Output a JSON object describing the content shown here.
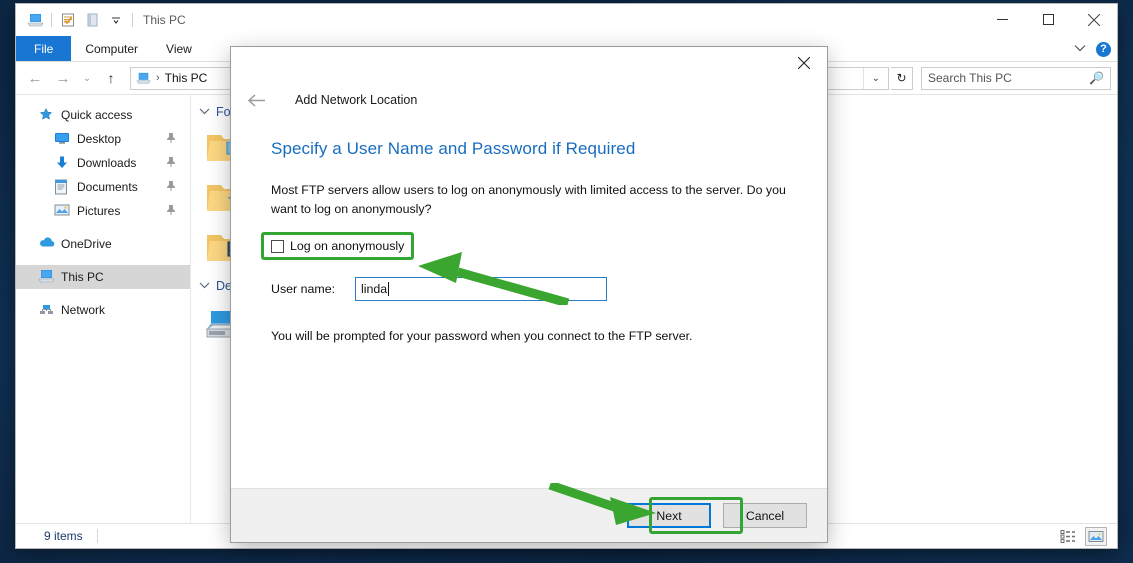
{
  "window": {
    "title": "This PC",
    "quick_access_icons": [
      "this-pc-icon",
      "properties-icon",
      "new-folder-icon",
      "customize-chevron-icon"
    ],
    "controls": {
      "minimize": "—",
      "maximize": "☐",
      "close": "✕"
    }
  },
  "ribbon": {
    "tabs": [
      {
        "label": "File",
        "active": true
      },
      {
        "label": "Computer",
        "active": false
      },
      {
        "label": "View",
        "active": false
      }
    ],
    "collapse_icon": "chevron-down-icon",
    "help_label": "?"
  },
  "addressbar": {
    "back_icon": "←",
    "forward_icon": "→",
    "recent_icon": "⌄",
    "up_icon": "↑",
    "crumb_icon": "this-pc-icon",
    "crumb": "This PC",
    "separator": "›",
    "dropdown_icon": "⌄",
    "refresh_icon": "↻",
    "search_placeholder": "Search This PC",
    "search_icon": "search-icon"
  },
  "navpane": {
    "items": [
      {
        "label": "Quick access",
        "icon": "star-icon",
        "indent": false,
        "pinned": false,
        "selected": false
      },
      {
        "label": "Desktop",
        "icon": "desktop-icon",
        "indent": true,
        "pinned": true,
        "selected": false
      },
      {
        "label": "Downloads",
        "icon": "downloads-icon",
        "indent": true,
        "pinned": true,
        "selected": false
      },
      {
        "label": "Documents",
        "icon": "documents-icon",
        "indent": true,
        "pinned": true,
        "selected": false
      },
      {
        "label": "Pictures",
        "icon": "pictures-icon",
        "indent": true,
        "pinned": true,
        "selected": false
      },
      {
        "label": "OneDrive",
        "icon": "onedrive-cloud-icon",
        "indent": false,
        "pinned": false,
        "selected": false
      },
      {
        "label": "This PC",
        "icon": "this-pc-icon",
        "indent": false,
        "pinned": false,
        "selected": true
      },
      {
        "label": "Network",
        "icon": "network-icon",
        "indent": false,
        "pinned": false,
        "selected": false
      }
    ],
    "pin_glyph": "📌"
  },
  "content": {
    "groups": [
      {
        "label": "Folders",
        "chevron": "⌄"
      },
      {
        "label": "Devices and drives",
        "chevron": "⌄"
      }
    ]
  },
  "statusbar": {
    "item_count": "9 items",
    "view_icons": [
      "details-view-icon",
      "large-icons-view-icon"
    ]
  },
  "dialog": {
    "title": "Add Network Location",
    "back_icon": "←",
    "close_icon": "✕",
    "heading": "Specify a User Name and Password if Required",
    "paragraph": "Most FTP servers allow users to log on anonymously with limited access to the server.  Do you want to log on anonymously?",
    "checkbox": {
      "label": "Log on anonymously",
      "checked": false
    },
    "username": {
      "label": "User name:",
      "value": "linda",
      "placeholder": ""
    },
    "note": "You will be prompted for your password when you connect to the FTP server.",
    "buttons": {
      "next": "Next",
      "cancel": "Cancel"
    }
  },
  "annotations": {
    "highlight_color": "#33a532",
    "arrow_color": "#3aa52f",
    "highlighted": [
      "log-on-anonymously-checkbox",
      "next-button"
    ],
    "arrows": [
      "arrow-to-username-field",
      "arrow-to-next-button"
    ]
  }
}
